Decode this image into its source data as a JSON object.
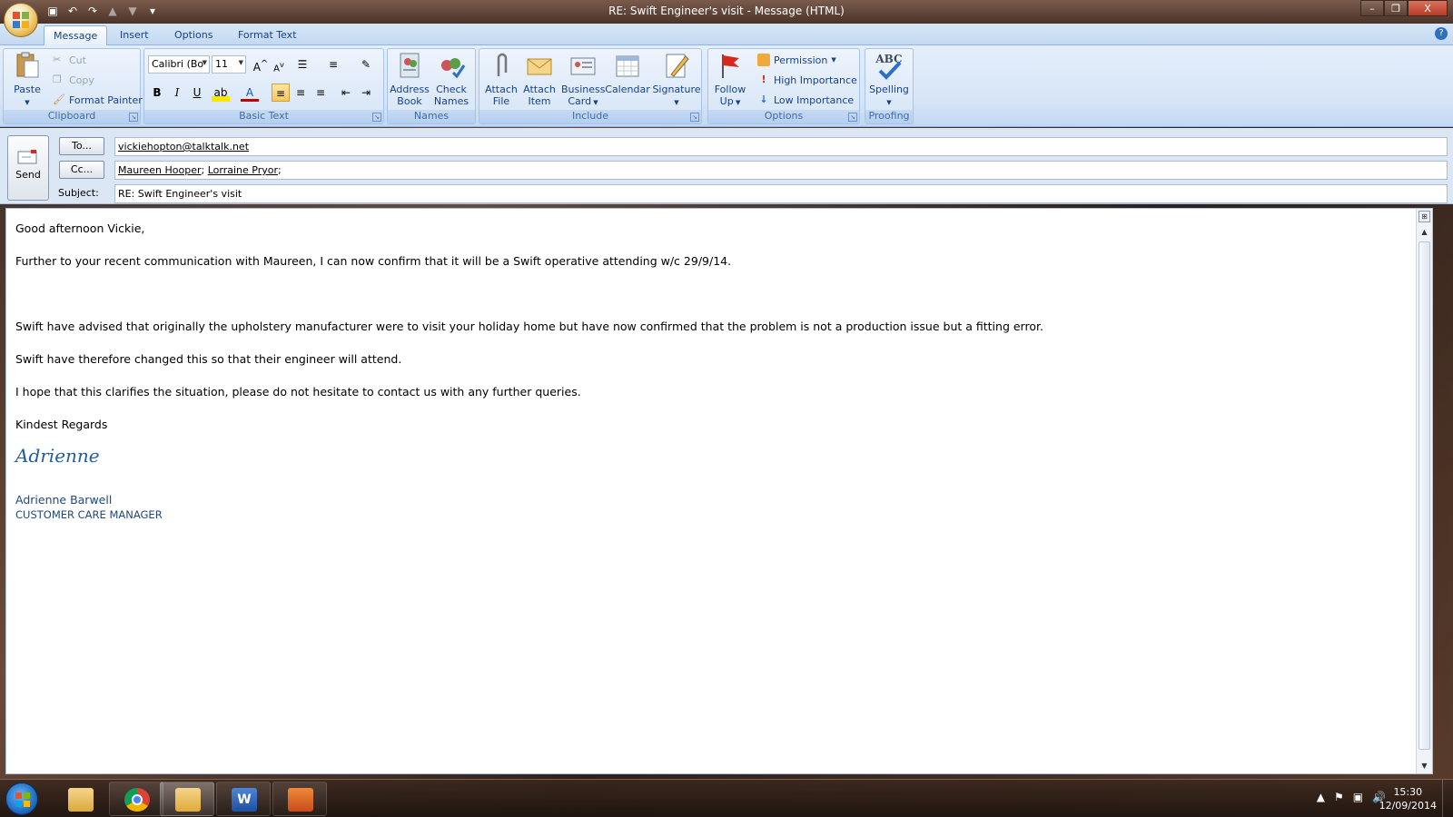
{
  "window": {
    "title": "RE: Swift Engineer's visit - Message (HTML)",
    "controls": [
      "–",
      "❐",
      "X"
    ]
  },
  "tabs": [
    "Message",
    "Insert",
    "Options",
    "Format Text"
  ],
  "ribbon": {
    "clipboard": {
      "label": "Clipboard",
      "paste": "Paste",
      "cut": "Cut",
      "copy": "Copy",
      "format_painter": "Format Painter"
    },
    "basic_text": {
      "label": "Basic Text",
      "font": "Calibri (Bo",
      "size": "11"
    },
    "names": {
      "label": "Names",
      "address_book_1": "Address",
      "address_book_2": "Book",
      "check_names_1": "Check",
      "check_names_2": "Names"
    },
    "include": {
      "label": "Include",
      "attach_file_1": "Attach",
      "attach_file_2": "File",
      "attach_item_1": "Attach",
      "attach_item_2": "Item",
      "business_card_1": "Business",
      "business_card_2": "Card",
      "calendar": "Calendar",
      "signature": "Signature"
    },
    "options": {
      "label": "Options",
      "follow_up_1": "Follow",
      "follow_up_2": "Up",
      "permission": "Permission",
      "high_importance": "High Importance",
      "low_importance": "Low Importance"
    },
    "proofing": {
      "label": "Proofing",
      "spelling": "Spelling",
      "spelling_icon_text": "ABC"
    }
  },
  "compose": {
    "send_label": "Send",
    "to_button": "To...",
    "cc_button": "Cc...",
    "subject_label": "Subject:",
    "to_value": "vickiehopton@talktalk.net",
    "cc_value_1": "Maureen Hooper",
    "cc_value_2": "Lorraine Pryor",
    "subject_value": "RE: Swift Engineer's visit"
  },
  "body": {
    "greeting": "Good afternoon Vickie,",
    "para1": "Further to your recent communication with Maureen, I can now confirm that it will be a Swift operative attending w/c 29/9/14.",
    "para2": "Swift have advised that originally the upholstery manufacturer were to visit your holiday home but have now confirmed  that the problem is  not a production issue but a fitting error.",
    "para3": "Swift have therefore changed this so that their engineer will attend.",
    "para4": "I hope that this clarifies the situation,  please do not hesitate to contact us with any further queries.",
    "closing": "Kindest Regards",
    "signature_script": "Adrienne",
    "sig_name": "Adrienne Barwell",
    "sig_title": "CUSTOMER CARE MANAGER"
  },
  "taskbar": {
    "time": "15:30",
    "date": "12/09/2014"
  }
}
